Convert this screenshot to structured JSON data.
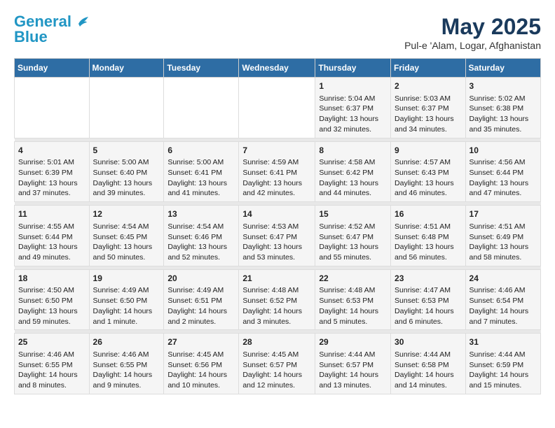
{
  "logo": {
    "line1": "General",
    "line2": "Blue"
  },
  "title": "May 2025",
  "location": "Pul-e 'Alam, Logar, Afghanistan",
  "days_of_week": [
    "Sunday",
    "Monday",
    "Tuesday",
    "Wednesday",
    "Thursday",
    "Friday",
    "Saturday"
  ],
  "weeks": [
    [
      {
        "day": "",
        "content": ""
      },
      {
        "day": "",
        "content": ""
      },
      {
        "day": "",
        "content": ""
      },
      {
        "day": "",
        "content": ""
      },
      {
        "day": "1",
        "content": "Sunrise: 5:04 AM\nSunset: 6:37 PM\nDaylight: 13 hours and 32 minutes."
      },
      {
        "day": "2",
        "content": "Sunrise: 5:03 AM\nSunset: 6:37 PM\nDaylight: 13 hours and 34 minutes."
      },
      {
        "day": "3",
        "content": "Sunrise: 5:02 AM\nSunset: 6:38 PM\nDaylight: 13 hours and 35 minutes."
      }
    ],
    [
      {
        "day": "4",
        "content": "Sunrise: 5:01 AM\nSunset: 6:39 PM\nDaylight: 13 hours and 37 minutes."
      },
      {
        "day": "5",
        "content": "Sunrise: 5:00 AM\nSunset: 6:40 PM\nDaylight: 13 hours and 39 minutes."
      },
      {
        "day": "6",
        "content": "Sunrise: 5:00 AM\nSunset: 6:41 PM\nDaylight: 13 hours and 41 minutes."
      },
      {
        "day": "7",
        "content": "Sunrise: 4:59 AM\nSunset: 6:41 PM\nDaylight: 13 hours and 42 minutes."
      },
      {
        "day": "8",
        "content": "Sunrise: 4:58 AM\nSunset: 6:42 PM\nDaylight: 13 hours and 44 minutes."
      },
      {
        "day": "9",
        "content": "Sunrise: 4:57 AM\nSunset: 6:43 PM\nDaylight: 13 hours and 46 minutes."
      },
      {
        "day": "10",
        "content": "Sunrise: 4:56 AM\nSunset: 6:44 PM\nDaylight: 13 hours and 47 minutes."
      }
    ],
    [
      {
        "day": "11",
        "content": "Sunrise: 4:55 AM\nSunset: 6:44 PM\nDaylight: 13 hours and 49 minutes."
      },
      {
        "day": "12",
        "content": "Sunrise: 4:54 AM\nSunset: 6:45 PM\nDaylight: 13 hours and 50 minutes."
      },
      {
        "day": "13",
        "content": "Sunrise: 4:54 AM\nSunset: 6:46 PM\nDaylight: 13 hours and 52 minutes."
      },
      {
        "day": "14",
        "content": "Sunrise: 4:53 AM\nSunset: 6:47 PM\nDaylight: 13 hours and 53 minutes."
      },
      {
        "day": "15",
        "content": "Sunrise: 4:52 AM\nSunset: 6:47 PM\nDaylight: 13 hours and 55 minutes."
      },
      {
        "day": "16",
        "content": "Sunrise: 4:51 AM\nSunset: 6:48 PM\nDaylight: 13 hours and 56 minutes."
      },
      {
        "day": "17",
        "content": "Sunrise: 4:51 AM\nSunset: 6:49 PM\nDaylight: 13 hours and 58 minutes."
      }
    ],
    [
      {
        "day": "18",
        "content": "Sunrise: 4:50 AM\nSunset: 6:50 PM\nDaylight: 13 hours and 59 minutes."
      },
      {
        "day": "19",
        "content": "Sunrise: 4:49 AM\nSunset: 6:50 PM\nDaylight: 14 hours and 1 minute."
      },
      {
        "day": "20",
        "content": "Sunrise: 4:49 AM\nSunset: 6:51 PM\nDaylight: 14 hours and 2 minutes."
      },
      {
        "day": "21",
        "content": "Sunrise: 4:48 AM\nSunset: 6:52 PM\nDaylight: 14 hours and 3 minutes."
      },
      {
        "day": "22",
        "content": "Sunrise: 4:48 AM\nSunset: 6:53 PM\nDaylight: 14 hours and 5 minutes."
      },
      {
        "day": "23",
        "content": "Sunrise: 4:47 AM\nSunset: 6:53 PM\nDaylight: 14 hours and 6 minutes."
      },
      {
        "day": "24",
        "content": "Sunrise: 4:46 AM\nSunset: 6:54 PM\nDaylight: 14 hours and 7 minutes."
      }
    ],
    [
      {
        "day": "25",
        "content": "Sunrise: 4:46 AM\nSunset: 6:55 PM\nDaylight: 14 hours and 8 minutes."
      },
      {
        "day": "26",
        "content": "Sunrise: 4:46 AM\nSunset: 6:55 PM\nDaylight: 14 hours and 9 minutes."
      },
      {
        "day": "27",
        "content": "Sunrise: 4:45 AM\nSunset: 6:56 PM\nDaylight: 14 hours and 10 minutes."
      },
      {
        "day": "28",
        "content": "Sunrise: 4:45 AM\nSunset: 6:57 PM\nDaylight: 14 hours and 12 minutes."
      },
      {
        "day": "29",
        "content": "Sunrise: 4:44 AM\nSunset: 6:57 PM\nDaylight: 14 hours and 13 minutes."
      },
      {
        "day": "30",
        "content": "Sunrise: 4:44 AM\nSunset: 6:58 PM\nDaylight: 14 hours and 14 minutes."
      },
      {
        "day": "31",
        "content": "Sunrise: 4:44 AM\nSunset: 6:59 PM\nDaylight: 14 hours and 15 minutes."
      }
    ]
  ]
}
